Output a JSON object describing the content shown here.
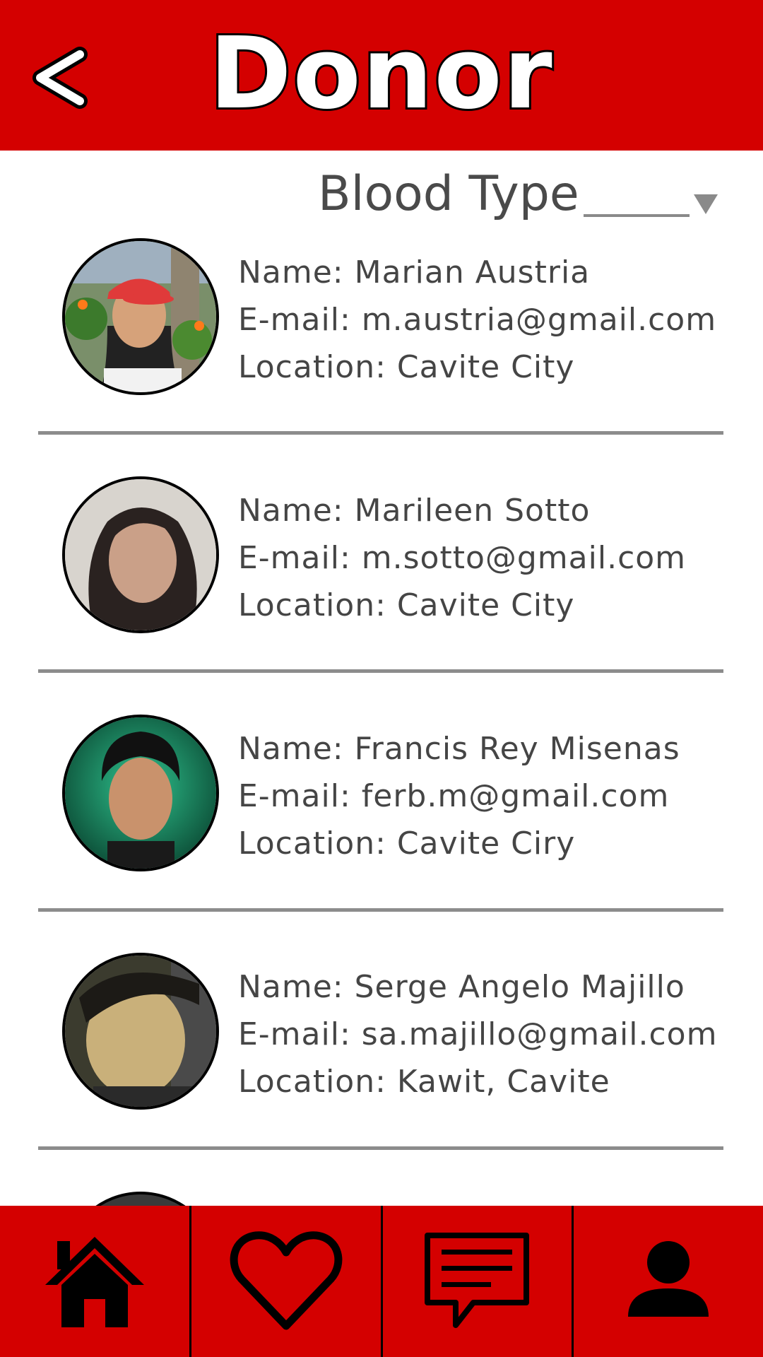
{
  "header": {
    "back_label": "<",
    "title": "Donor",
    "back_icon": "chevron-left-icon"
  },
  "filter": {
    "label": "Blood Type",
    "value": "",
    "dropdown_icon": "triangle-down-icon"
  },
  "donors": [
    {
      "name": "Name: Marian Austria",
      "email": "E-mail: m.austria@gmail.com",
      "location": "Location: Cavite City"
    },
    {
      "name": "Name: Marileen Sotto",
      "email": "E-mail: m.sotto@gmail.com",
      "location": "Location: Cavite City"
    },
    {
      "name": "Name: Francis Rey Misenas",
      "email": "E-mail: ferb.m@gmail.com",
      "location": "Location: Cavite Ciry"
    },
    {
      "name": "Name: Serge Angelo Majillo",
      "email": "E-mail: sa.majillo@gmail.com",
      "location": "Location: Kawit, Cavite"
    }
  ],
  "nav": [
    {
      "icon": "home-icon"
    },
    {
      "icon": "heart-icon"
    },
    {
      "icon": "chat-icon"
    },
    {
      "icon": "profile-icon"
    }
  ],
  "colors": {
    "primary": "#d40000",
    "text": "#454545",
    "divider": "#8c8c8c"
  }
}
